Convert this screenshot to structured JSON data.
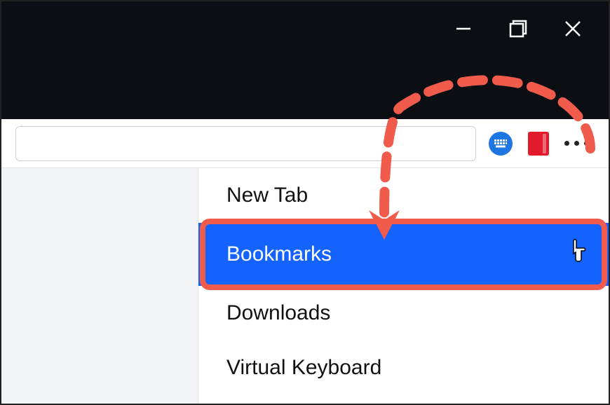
{
  "window": {
    "controls": {
      "minimize": "minimize",
      "maximize": "maximize",
      "close": "close"
    }
  },
  "toolbar": {
    "icons": {
      "keyboard": "keyboard-icon",
      "bookmarks_tool": "bookmarks-tool-icon",
      "more": "more-menu-icon"
    }
  },
  "menu": {
    "items": [
      {
        "label": "New Tab",
        "selected": false
      },
      {
        "label": "Bookmarks",
        "selected": true,
        "highlighted": true
      },
      {
        "label": "Downloads",
        "selected": false
      },
      {
        "label": "Virtual Keyboard",
        "selected": false
      }
    ]
  },
  "annotation": {
    "arrow_color": "#f05b4b",
    "highlight_color": "#f05b4b",
    "target": "Bookmarks"
  }
}
